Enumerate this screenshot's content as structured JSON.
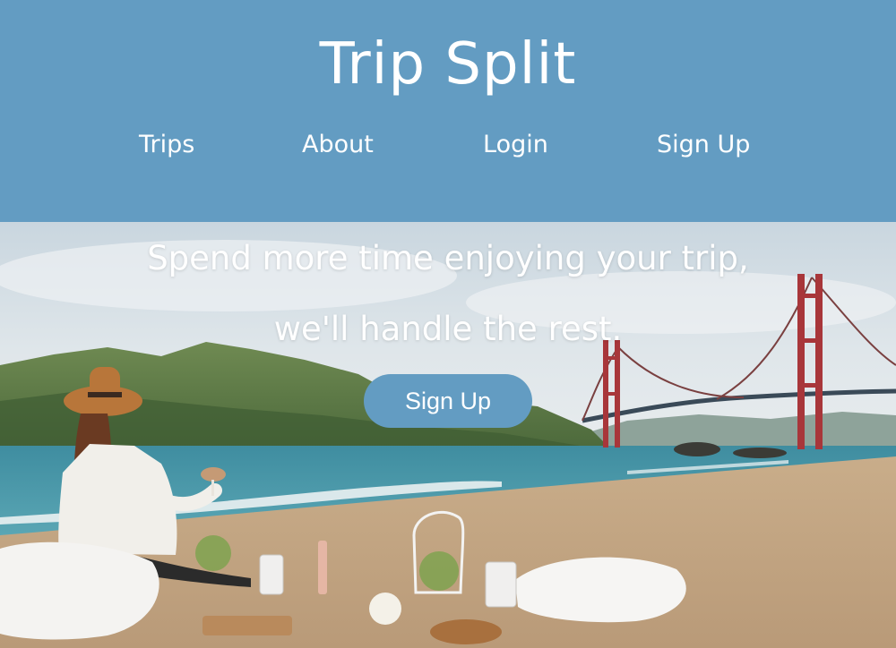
{
  "header": {
    "brand": "Trip Split",
    "nav": [
      {
        "label": "Trips"
      },
      {
        "label": "About"
      },
      {
        "label": "Login"
      },
      {
        "label": "Sign Up"
      }
    ]
  },
  "hero": {
    "headline_line1": "Spend more time enjoying your trip,",
    "headline_line2": "we'll handle the rest.",
    "cta_label": "Sign Up"
  },
  "colors": {
    "header_background": "#639cc2",
    "button_background": "#639cc2",
    "text": "#ffffff"
  }
}
